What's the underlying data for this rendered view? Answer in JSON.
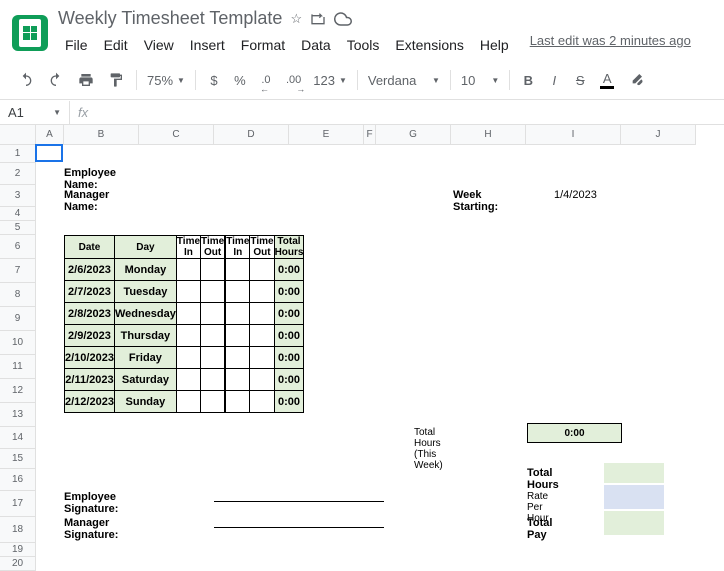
{
  "doc": {
    "title": "Weekly Timesheet Template",
    "last_edit": "Last edit was 2 minutes ago"
  },
  "menu": {
    "file": "File",
    "edit": "Edit",
    "view": "View",
    "insert": "Insert",
    "format": "Format",
    "data": "Data",
    "tools": "Tools",
    "extensions": "Extensions",
    "help": "Help"
  },
  "toolbar": {
    "zoom": "75%",
    "currency": "$",
    "percent": "%",
    "dec_dec": ".0",
    "dec_inc": ".00",
    "num_format": "123",
    "font": "Verdana",
    "font_size": "10"
  },
  "namebox": {
    "cell": "A1",
    "fx": "fx"
  },
  "cols": [
    "A",
    "B",
    "C",
    "D",
    "E",
    "F",
    "G",
    "H",
    "I",
    "J"
  ],
  "rows": [
    "1",
    "2",
    "3",
    "4",
    "5",
    "6",
    "7",
    "8",
    "9",
    "10",
    "11",
    "12",
    "13",
    "14",
    "15",
    "16",
    "17",
    "18",
    "19",
    "20"
  ],
  "sheet": {
    "employee_name_label": "Employee Name:",
    "manager_name_label": "Manager Name:",
    "week_starting_label": "Week Starting:",
    "week_starting_value": "1/4/2023",
    "headers": {
      "date": "Date",
      "day": "Day",
      "time_in": "Time In",
      "time_out": "Time Out",
      "total_hours": "Total Hours"
    },
    "rows": [
      {
        "date": "2/6/2023",
        "day": "Monday",
        "total": "0:00"
      },
      {
        "date": "2/7/2023",
        "day": "Tuesday",
        "total": "0:00"
      },
      {
        "date": "2/8/2023",
        "day": "Wednesday",
        "total": "0:00"
      },
      {
        "date": "2/9/2023",
        "day": "Thursday",
        "total": "0:00"
      },
      {
        "date": "2/10/2023",
        "day": "Friday",
        "total": "0:00"
      },
      {
        "date": "2/11/2023",
        "day": "Saturday",
        "total": "0:00"
      },
      {
        "date": "2/12/2023",
        "day": "Sunday",
        "total": "0:00"
      }
    ],
    "total_hours_week_label": "Total Hours (This Week)",
    "total_hours_week_value": "0:00",
    "employee_signature_label": "Employee Signature:",
    "manager_signature_label": "Manager Signature:",
    "summary": {
      "total_hours": "Total Hours",
      "rate_per_hour": "Rate Per Hour",
      "total_pay": "Total Pay"
    }
  }
}
